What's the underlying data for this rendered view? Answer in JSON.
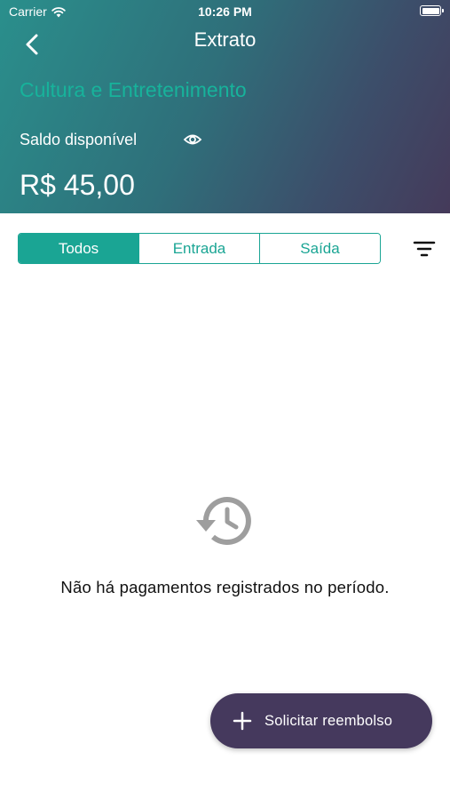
{
  "status_bar": {
    "carrier": "Carrier",
    "time": "10:26 PM"
  },
  "header": {
    "title": "Extrato",
    "category": "Cultura e Entretenimento",
    "balance_label": "Saldo disponível",
    "balance_value": "R$ 45,00"
  },
  "tabs": [
    {
      "label": "Todos",
      "active": true
    },
    {
      "label": "Entrada",
      "active": false
    },
    {
      "label": "Saída",
      "active": false
    }
  ],
  "empty_state": {
    "message": "Não há pagamentos registrados no período."
  },
  "fab": {
    "label": "Solicitar reembolso"
  },
  "icons": {
    "back": "chevron-left-icon",
    "eye": "eye-icon",
    "filter": "filter-icon",
    "history": "history-icon",
    "plus": "plus-icon",
    "wifi": "wifi-icon",
    "battery": "battery-icon"
  },
  "colors": {
    "accent": "#1aa594",
    "category_text": "#17b39b",
    "fab_background": "#45395d",
    "header_gradient_start": "#2a8f8c",
    "header_gradient_end": "#453a5a",
    "icon_gray": "#9e9e9e"
  }
}
